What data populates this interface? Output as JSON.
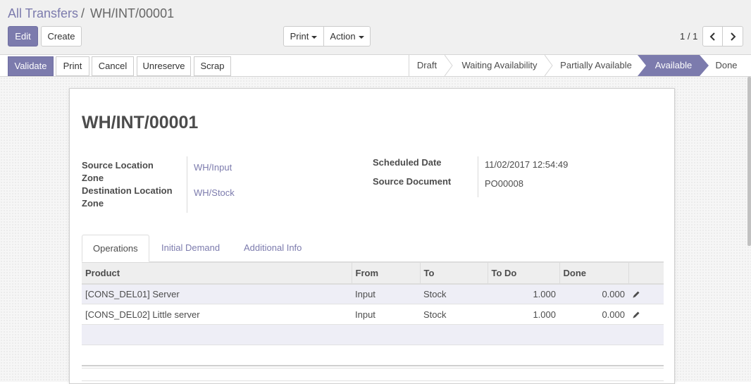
{
  "breadcrumb": {
    "parent": "All Transfers",
    "separator": "/",
    "current": "WH/INT/00001"
  },
  "toolbar": {
    "edit": "Edit",
    "create": "Create",
    "print": "Print",
    "action": "Action"
  },
  "pager": {
    "value": "1 / 1"
  },
  "actions": {
    "validate": "Validate",
    "print": "Print",
    "cancel": "Cancel",
    "unreserve": "Unreserve",
    "scrap": "Scrap"
  },
  "stages": [
    {
      "label": "Draft",
      "active": false
    },
    {
      "label": "Waiting Availability",
      "active": false
    },
    {
      "label": "Partially Available",
      "active": false
    },
    {
      "label": "Available",
      "active": true
    },
    {
      "label": "Done",
      "active": false
    }
  ],
  "record": {
    "title": "WH/INT/00001",
    "source_location_label": "Source Location",
    "zone_label": "Zone",
    "source_location": "WH/Input",
    "destination_location_label": "Destination Location",
    "destination_location": "WH/Stock",
    "scheduled_date_label": "Scheduled Date",
    "scheduled_date": "11/02/2017 12:54:49",
    "source_document_label": "Source Document",
    "source_document": "PO00008"
  },
  "tabs": [
    {
      "label": "Operations",
      "active": true
    },
    {
      "label": "Initial Demand",
      "active": false
    },
    {
      "label": "Additional Info",
      "active": false
    }
  ],
  "table": {
    "columns": [
      "Product",
      "From",
      "To",
      "To Do",
      "Done"
    ],
    "rows": [
      {
        "product": "[CONS_DEL01] Server",
        "from": "Input",
        "to": "Stock",
        "todo": "1.000",
        "done": "0.000"
      },
      {
        "product": "[CONS_DEL02] Little server",
        "from": "Input",
        "to": "Stock",
        "todo": "1.000",
        "done": "0.000"
      }
    ]
  },
  "colors": {
    "primary": "#7c7bad",
    "text": "#4c4c4c",
    "panel": "#f0f0f0"
  },
  "icons": {
    "pager_prev": "chevron-left-icon",
    "pager_next": "chevron-right-icon",
    "row_edit": "pencil-icon"
  }
}
